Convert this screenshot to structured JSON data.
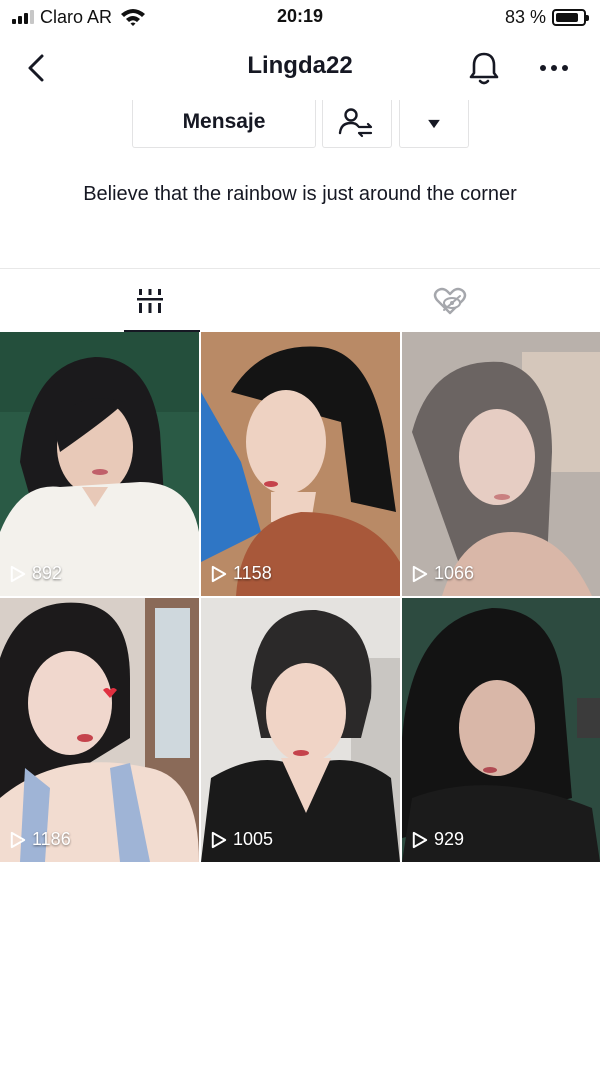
{
  "status_bar": {
    "carrier": "Claro AR",
    "time": "20:19",
    "battery": "83 %",
    "battery_level": 0.83
  },
  "nav": {
    "title": "Lingda22",
    "icons": [
      "back-chevron-icon",
      "bell-icon",
      "more-dots-icon"
    ]
  },
  "actions": {
    "message_label": "Mensaje",
    "follow_icon": "user-swap-icon",
    "dropdown_icon": "triangle-down-icon"
  },
  "bio": "Believe that the rainbow is just around the corner",
  "tabs": [
    {
      "id": "videos",
      "icon": "grid-bars-icon",
      "active": true
    },
    {
      "id": "liked",
      "icon": "hidden-heart-icon",
      "active": false
    }
  ],
  "videos": [
    {
      "views": "892"
    },
    {
      "views": "1158"
    },
    {
      "views": "1066"
    },
    {
      "views": "1186"
    },
    {
      "views": "1005"
    },
    {
      "views": "929"
    }
  ],
  "colors": {
    "text": "#161823",
    "border": "#e3e3e4",
    "divider": "#e8e8e8"
  }
}
